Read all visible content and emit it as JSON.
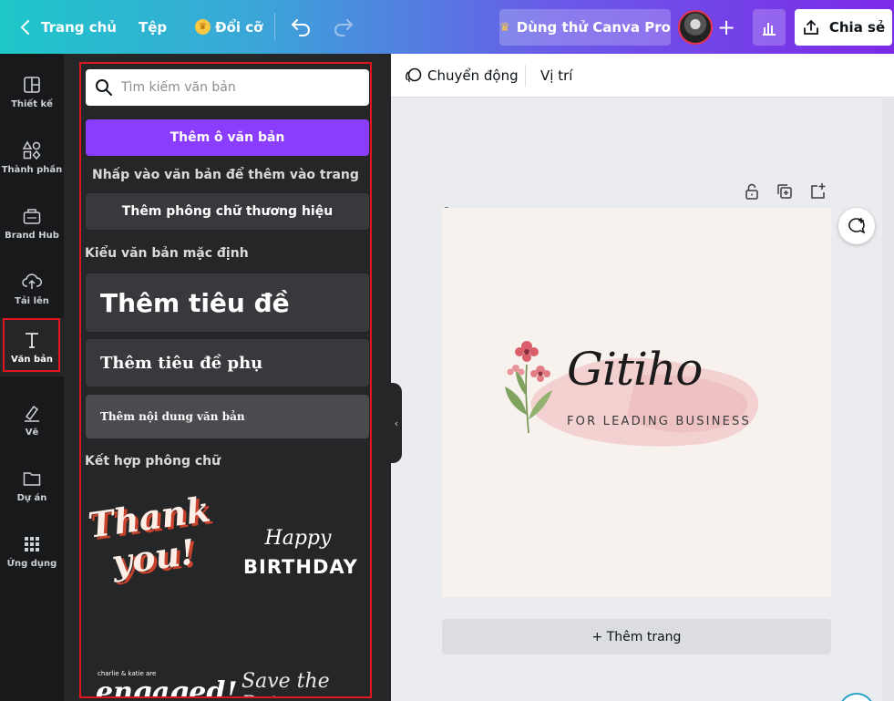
{
  "topbar": {
    "home_label": "Trang chủ",
    "file_label": "Tệp",
    "resize_label": "Đổi cỡ",
    "pro_label": "Dùng thử Canva Pro",
    "share_label": "Chia sẻ"
  },
  "rail": {
    "items": [
      {
        "label": "Thiết kế"
      },
      {
        "label": "Thành phần"
      },
      {
        "label": "Brand Hub"
      },
      {
        "label": "Tải lên"
      },
      {
        "label": "Văn bản"
      },
      {
        "label": "Vẽ"
      },
      {
        "label": "Dự án"
      },
      {
        "label": "Ứng dụng"
      }
    ]
  },
  "panel": {
    "search_placeholder": "Tìm kiếm văn bản",
    "add_box_label": "Thêm ô văn bản",
    "hint": "Nhấp vào văn bản để thêm vào trang",
    "brand_font_label": "Thêm phông chữ thương hiệu",
    "default_styles_title": "Kiểu văn bản mặc định",
    "heading_label": "Thêm tiêu đề",
    "subheading_label": "Thêm tiêu đề phụ",
    "body_label": "Thêm nội dung văn bản",
    "combos_title": "Kết hợp phông chữ",
    "combos": {
      "thank_1": "Thank",
      "thank_2": "you!",
      "happy": "Happy",
      "birthday": "BIRTHDAY",
      "couple": "charlie & katie are",
      "engaged": "engaged!",
      "save_date": "Save the Date"
    }
  },
  "toolbar": {
    "animate_label": "Chuyển động",
    "position_label": "Vị trí"
  },
  "canvas": {
    "logo_script": "Gitiho",
    "logo_tagline": "FOR LEADING BUSINESS",
    "add_page_label": "+ Thêm trang"
  },
  "colors": {
    "accent_purple": "#8b3dff",
    "highlight_red": "#e0151d",
    "panel_dark": "#252627",
    "rail_dark": "#18191b"
  }
}
